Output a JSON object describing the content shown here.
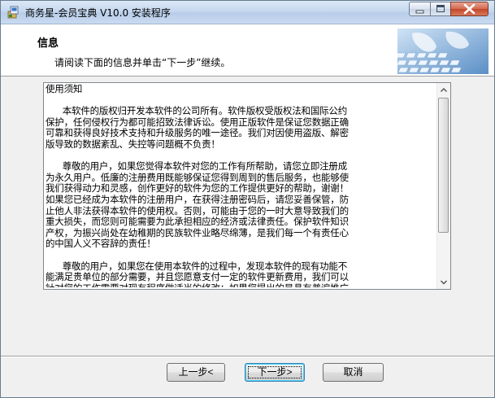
{
  "window": {
    "title": "商务星-会员宝典 V10.0 安装程序"
  },
  "header": {
    "title": "信息",
    "subtitle": "请阅读下面的信息并单击“下一步”继续。"
  },
  "info": {
    "lines": [
      "使用须知",
      "",
      "      本软件的版权归开发本软件的公司所有。软件版权受版权法和国际公约",
      "保护，任何侵权行为都可能招致法律诉讼。使用正版软件是保证您数据正确",
      "可靠和获得良好技术支持和升级服务的唯一途径。我们对因使用盗版、解密",
      "版导致的数据紊乱、失控等问题概不负责！",
      "",
      "      尊敬的用户，如果您觉得本软件对您的工作有所帮助，请您立即注册成",
      "为永久用户。低廉的注册费用既能够保证您得到周到的售后服务，也能够使",
      "我们获得动力和灵感，创作更好的软件为您的工作提供更好的帮助，谢谢！",
      "如果您已经成为本软件的注册用户，在获得注册密码后，请您妥善保管，防",
      "止他人非法获得本软件的使用权。否则，可能由于您的一时大意导致我们的",
      "重大损失，而您则可能需要为此承担相应的经济或法律责任。保护软件知识",
      "产权，为振兴尚处在幼稚期的民族软件业略尽绵薄，是我们每一个有责任心",
      "的中国人义不容辞的责任！",
      "",
      "      尊敬的用户，如果您在使用本软件的过程中，发现本软件的现有功能不",
      "能满足贵单位的部分需要，并且您愿意支付一定的软件更新费用，我们可以",
      "针对您的工作需要对现有程序做适当的修改；如果您提出的是具有普遍推广",
      "意义的合理化建议，我们将尽快更新软件，并且为您免费升级。"
    ]
  },
  "buttons": {
    "back": "上一步<",
    "next": "下一步>",
    "cancel": "取消"
  },
  "icons": {
    "minimize": "minimize-icon",
    "maximize": "maximize-icon",
    "close": "close-icon"
  }
}
